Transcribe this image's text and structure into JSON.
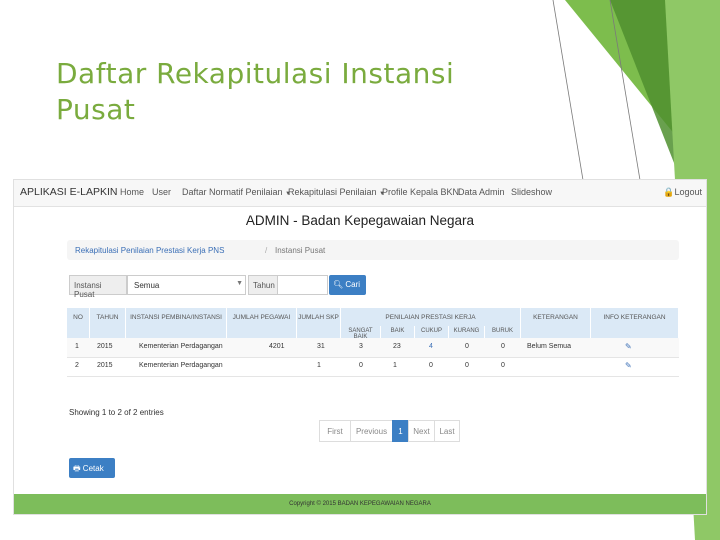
{
  "slide": {
    "title": "Daftar Rekapitulasi Instansi Pusat"
  },
  "app": {
    "brand": "APLIKASI E-LAPKIN",
    "nav": [
      "Home",
      "User",
      "Daftar Normatif Penilaian",
      "Rekapitulasi Penilaian",
      "Profile Kepala BKN",
      "Data Admin",
      "Slideshow"
    ],
    "logout": "Logout",
    "heading": "ADMIN - Badan Kepegawaian Negara"
  },
  "breadcrumb": [
    "Rekapitulasi Penilaian Prestasi Kerja PNS",
    "Instansi Pusat"
  ],
  "filter": {
    "instansi_label": "Instansi Pusat",
    "instansi_value": "Semua",
    "tahun_label": "Tahun",
    "search_button": "Cari"
  },
  "table": {
    "headers": [
      "NO",
      "TAHUN",
      "INSTANSI PEMBINA/INSTANSI",
      "JUMLAH PEGAWAI",
      "JUMLAH SKP",
      "PENILAIAN PRESTASI KERJA",
      "KETERANGAN",
      "INFO KETERANGAN"
    ],
    "subheaders": [
      "SANGAT BAIK",
      "BAIK",
      "CUKUP",
      "KURANG",
      "BURUK"
    ],
    "rows": [
      [
        "1",
        "2015",
        "Kementerian Perdagangan",
        "4201",
        "31",
        "3",
        "23",
        "4",
        "0",
        "0",
        "Belum Semua"
      ],
      [
        "2",
        "2015",
        "Kementerian Perdagangan",
        "",
        "1",
        "0",
        "1",
        "0",
        "0",
        "0",
        ""
      ]
    ]
  },
  "showing": "Showing 1 to 2 of 2 entries",
  "pagination": [
    "First",
    "Previous",
    "1",
    "Next",
    "Last"
  ],
  "print_button": "Cetak",
  "footer": "Copyright © 2015 BADAN KEPEGAWAIAN NEGARA",
  "colors": {
    "accent_green": "#7aab3e",
    "primary_blue": "#3c7fc4",
    "footer_green": "#7dbd5b"
  }
}
